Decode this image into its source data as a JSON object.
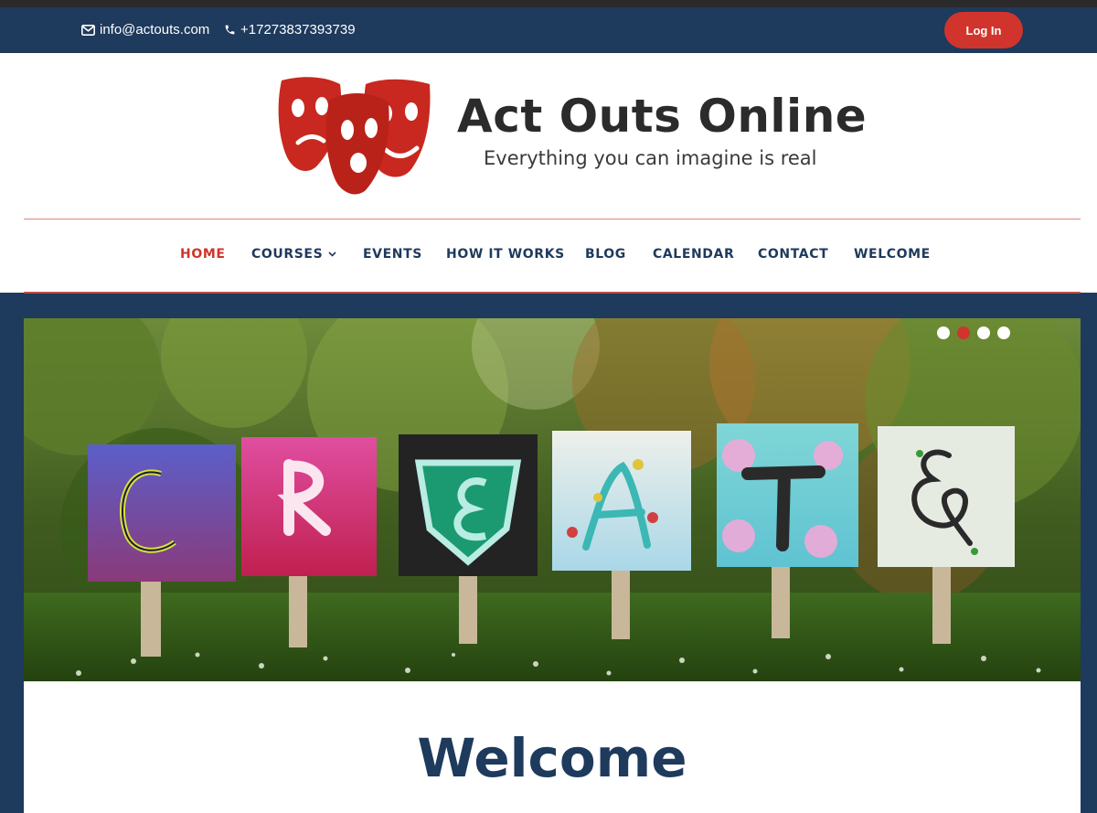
{
  "topbar": {
    "email": "info@actouts.com",
    "phone": "+17273837393739",
    "login_label": "Log In"
  },
  "header": {
    "site_title": "Act Outs Online",
    "tagline": "Everything you can imagine is real"
  },
  "nav": {
    "items": [
      {
        "label": "HOME",
        "active": true
      },
      {
        "label": "COURSES",
        "has_dropdown": true
      },
      {
        "label": "EVENTS"
      },
      {
        "label": "HOW IT WORKS"
      },
      {
        "label": "BLOG"
      },
      {
        "label": "CALENDAR"
      },
      {
        "label": "CONTACT"
      },
      {
        "label": "WELCOME"
      }
    ]
  },
  "hero": {
    "sign_letters": [
      "C",
      "R",
      "E",
      "A",
      "T",
      "E"
    ],
    "slide_count": 4,
    "active_slide": 2
  },
  "main": {
    "heading": "Welcome"
  },
  "colors": {
    "navy": "#1e3a5c",
    "accent_red": "#d0342c",
    "white": "#ffffff"
  },
  "icons": [
    "envelope-icon",
    "phone-icon",
    "chevron-down-icon",
    "theater-masks-logo"
  ]
}
